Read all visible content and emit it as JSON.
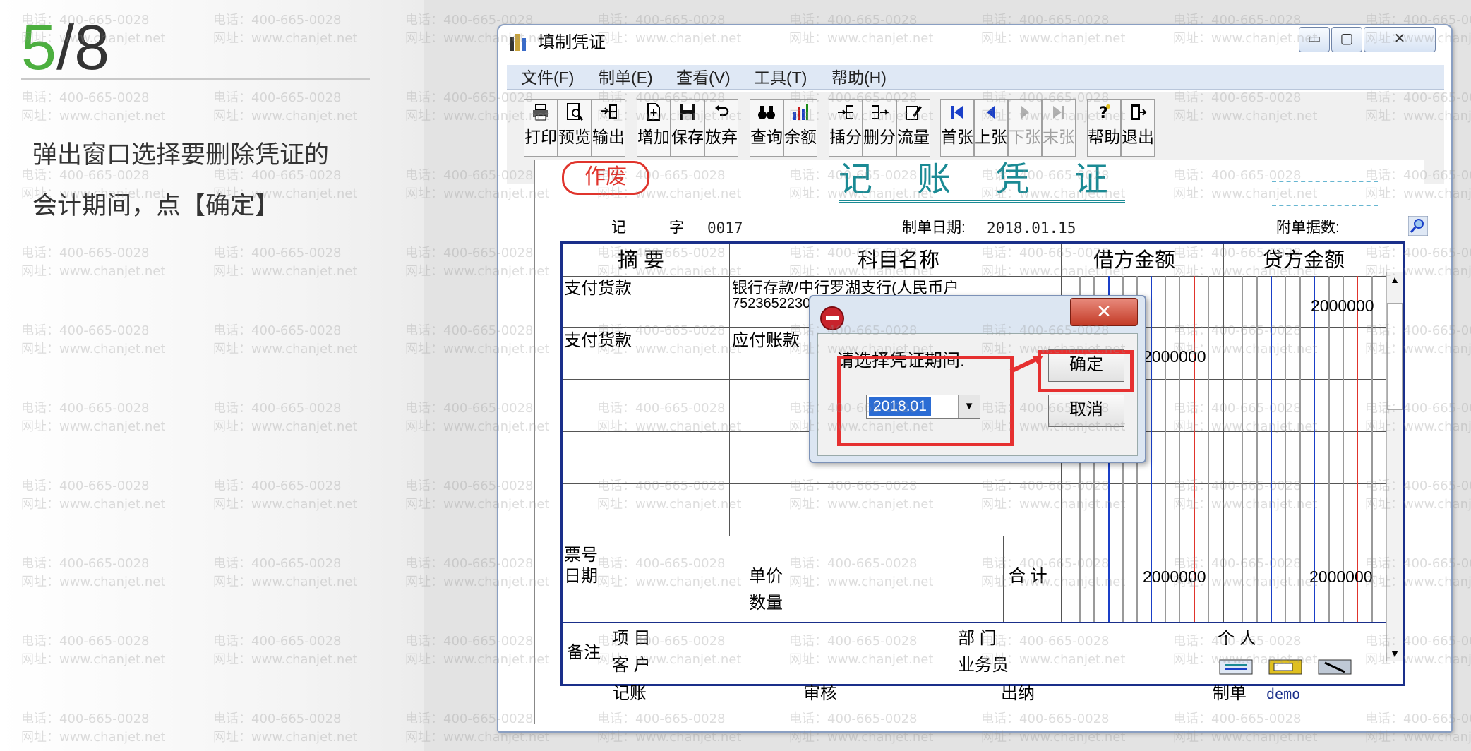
{
  "slide": {
    "step_current": "5",
    "step_total": "/8",
    "instruction_line1": "弹出窗口选择要删除凭证的",
    "instruction_line2": "会计期间，点【确定】"
  },
  "watermark": {
    "phone": "电话：400-665-0028",
    "site": "网址：www.chanjet.net"
  },
  "window": {
    "title": "填制凭证",
    "minimize": "▭",
    "maximize": "▢",
    "close": "✕"
  },
  "menu": [
    "文件(F)",
    "制单(E)",
    "查看(V)",
    "工具(T)",
    "帮助(H)"
  ],
  "toolbar": {
    "print": "打印",
    "preview": "预览",
    "export": "输出",
    "add": "增加",
    "save": "保存",
    "abandon": "放弃",
    "query": "查询",
    "balance": "余额",
    "insert_row": "插分",
    "delete_row": "删分",
    "cash_flow": "流量",
    "first": "首张",
    "prev": "上张",
    "next": "下张",
    "last": "末张",
    "help": "帮助",
    "exit": "退出"
  },
  "voucher": {
    "void_stamp": "作废",
    "title": "记 账 凭 证",
    "word_label": "记",
    "zi_label": "字",
    "number": "0017",
    "date_label": "制单日期:",
    "date": "2018.01.15",
    "attachments_label": "附单据数:",
    "col_summary": "摘 要",
    "col_account": "科目名称",
    "col_debit": "借方金额",
    "col_credit": "贷方金额",
    "rows": [
      {
        "summary": "支付货款",
        "account": "银行存款/中行罗湖支行(人民币户",
        "account2": "7523652230",
        "debit": "",
        "credit": "2000000"
      },
      {
        "summary": "支付货款",
        "account": "应付账款",
        "account2": "",
        "debit": "2000000",
        "credit": ""
      }
    ],
    "ticket_no": "票号",
    "ticket_date": "日期",
    "unit_price": "单价",
    "quantity": "数量",
    "total_label": "合 计",
    "total_debit": "2000000",
    "total_credit": "2000000",
    "remark": "备注",
    "project": "项 目",
    "customer": "客 户",
    "department": "部 门",
    "salesman": "业务员",
    "person": "个 人",
    "bookkeeping": "记账",
    "audit": "审核",
    "cashier": "出纳",
    "maker": "制单",
    "maker_name": "demo"
  },
  "dialog": {
    "close": "✕",
    "label": "请选择凭证期间:",
    "period": "2018.01",
    "ok": "确定",
    "cancel": "取消"
  },
  "colors": {
    "accent_green": "#4caf3f",
    "highlight_red": "#e63030",
    "voucher_teal": "#1a8a94",
    "grid_blue": "#1a2f8a"
  }
}
